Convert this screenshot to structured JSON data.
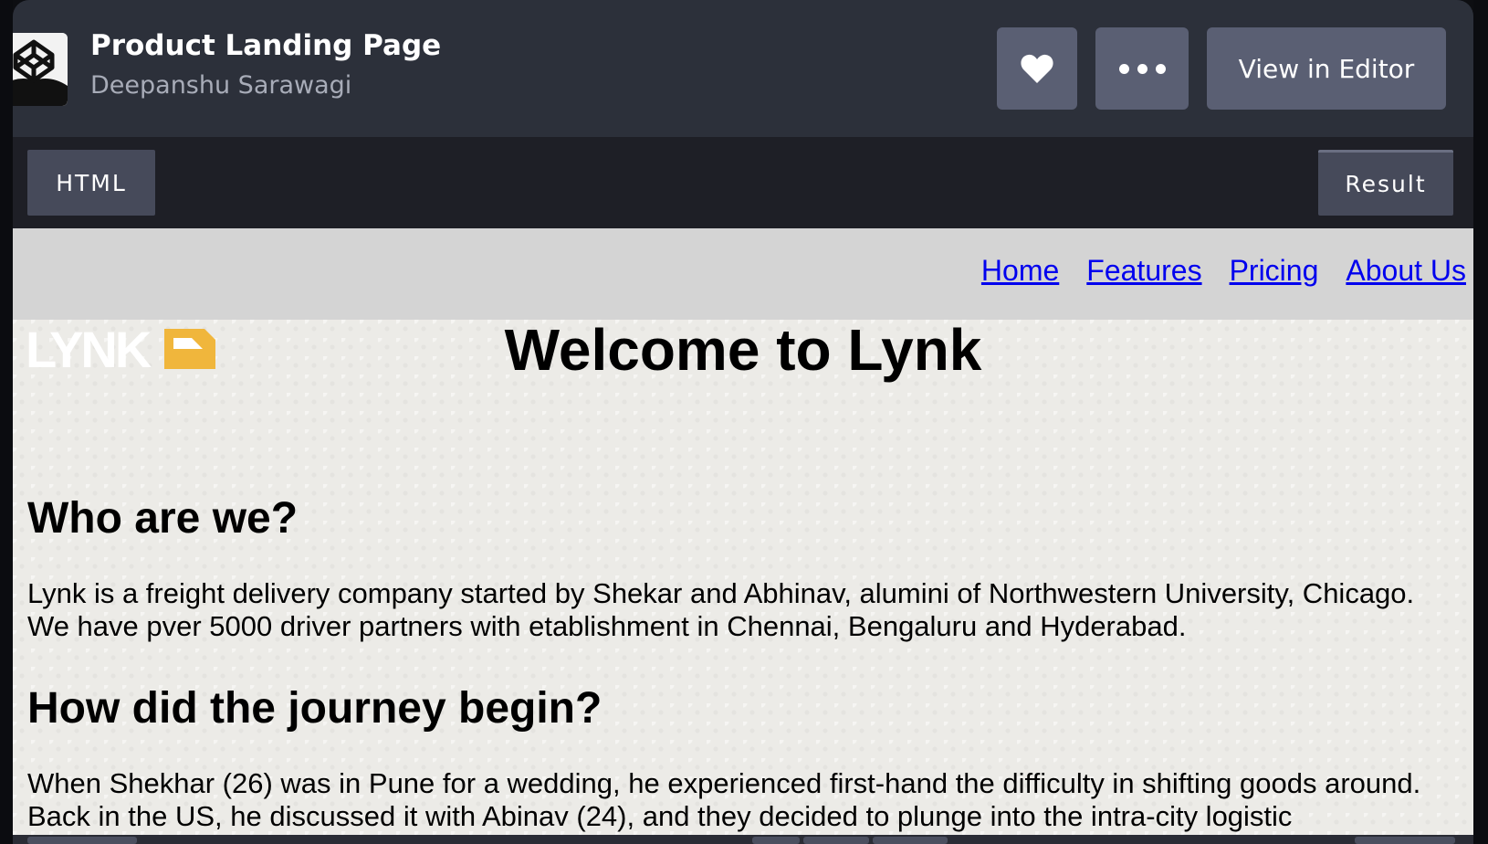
{
  "embed": {
    "title": "Product Landing Page",
    "author": "Deepanshu Sarawagi",
    "like_icon": "heart-icon",
    "more_icon": "more-dots-icon",
    "editor_button": "View in Editor"
  },
  "tabs": {
    "html": "HTML",
    "result": "Result",
    "active": "Result"
  },
  "page": {
    "nav": [
      "Home",
      "Features",
      "Pricing",
      "About Us"
    ],
    "logo_text": "LYNK",
    "welcome": "Welcome to Lynk",
    "sections": [
      {
        "heading": "Who are we?",
        "body": "Lynk is a freight delivery company started by Shekar and Abhinav, alumini of Northwestern University, Chicago. We have pver 5000 driver partners with etablishment in Chennai, Bengaluru and Hyderabad."
      },
      {
        "heading": "How did the journey begin?",
        "body": "When Shekhar (26) was in Pune for a wedding, he experienced first-hand the difficulty in shifting goods around. Back in the US, he discussed it with Abinav (24), and they decided to plunge into the intra-city logistic"
      }
    ]
  },
  "colors": {
    "header_bg": "#2c303a",
    "button_bg": "#5a5f73",
    "tab_bg": "#464a5a",
    "nav_bg": "#d4d4d4",
    "link": "#0000ee",
    "logo_accent": "#f0b63c"
  }
}
